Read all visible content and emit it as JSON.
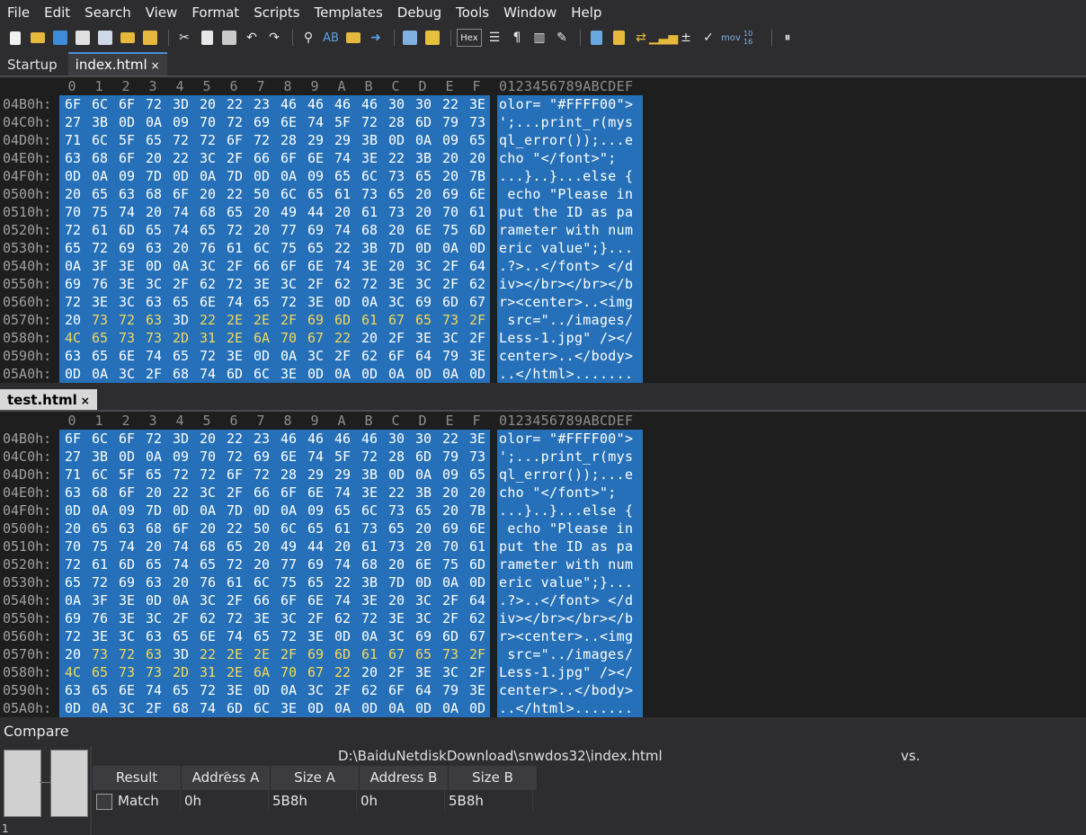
{
  "menu": [
    "File",
    "Edit",
    "Search",
    "View",
    "Format",
    "Scripts",
    "Templates",
    "Debug",
    "Tools",
    "Window",
    "Help"
  ],
  "toolbar": {
    "icons": [
      "new-file-icon",
      "open-folder-icon",
      "save-icon",
      "save-as-icon",
      "save-all-icon",
      "close-folder-icon",
      "open-project-icon",
      "cut-icon",
      "copy-icon",
      "paste-icon",
      "undo-icon",
      "redo-icon",
      "find-icon",
      "replace-icon",
      "find-in-files-icon",
      "goto-icon",
      "compare-icon",
      "bookmark-icon",
      "hex-view-icon",
      "format-icon",
      "paragraph-icon",
      "columns-icon",
      "highlight-icon",
      "calculator-icon",
      "clipboard-icon",
      "swap-icon",
      "histogram-icon",
      "plus-minus-icon",
      "checksum-icon",
      "mov-asm-icon",
      "base-convert-icon",
      "pause-icon"
    ],
    "hex_label": "Hex",
    "mov_label": "mov",
    "base_label": "10 16"
  },
  "tabs_top": [
    {
      "label": "Startup"
    },
    {
      "label": "index.html",
      "close": "×"
    }
  ],
  "tabs_bottom": [
    {
      "label": "test.html",
      "close": "×"
    }
  ],
  "hex_header": {
    "columns": [
      "0",
      "1",
      "2",
      "3",
      "4",
      "5",
      "6",
      "7",
      "8",
      "9",
      "A",
      "B",
      "C",
      "D",
      "E",
      "F"
    ],
    "ascii_header": "0123456789ABCDEF"
  },
  "hex_rows": [
    {
      "addr": "04B0h:",
      "bytes": [
        "6F",
        "6C",
        "6F",
        "72",
        "3D",
        "20",
        "22",
        "23",
        "46",
        "46",
        "46",
        "46",
        "30",
        "30",
        "22",
        "3E"
      ],
      "ascii": "olor= \"#FFFF00\">"
    },
    {
      "addr": "04C0h:",
      "bytes": [
        "27",
        "3B",
        "0D",
        "0A",
        "09",
        "70",
        "72",
        "69",
        "6E",
        "74",
        "5F",
        "72",
        "28",
        "6D",
        "79",
        "73"
      ],
      "ascii": "';...print_r(mys"
    },
    {
      "addr": "04D0h:",
      "bytes": [
        "71",
        "6C",
        "5F",
        "65",
        "72",
        "72",
        "6F",
        "72",
        "28",
        "29",
        "29",
        "3B",
        "0D",
        "0A",
        "09",
        "65"
      ],
      "ascii": "ql_error());...e"
    },
    {
      "addr": "04E0h:",
      "bytes": [
        "63",
        "68",
        "6F",
        "20",
        "22",
        "3C",
        "2F",
        "66",
        "6F",
        "6E",
        "74",
        "3E",
        "22",
        "3B",
        "20",
        "20"
      ],
      "ascii": "cho \"</font>\";  "
    },
    {
      "addr": "04F0h:",
      "bytes": [
        "0D",
        "0A",
        "09",
        "7D",
        "0D",
        "0A",
        "7D",
        "0D",
        "0A",
        "09",
        "65",
        "6C",
        "73",
        "65",
        "20",
        "7B"
      ],
      "ascii": "...}..}...else {"
    },
    {
      "addr": "0500h:",
      "bytes": [
        "20",
        "65",
        "63",
        "68",
        "6F",
        "20",
        "22",
        "50",
        "6C",
        "65",
        "61",
        "73",
        "65",
        "20",
        "69",
        "6E"
      ],
      "ascii": " echo \"Please in"
    },
    {
      "addr": "0510h:",
      "bytes": [
        "70",
        "75",
        "74",
        "20",
        "74",
        "68",
        "65",
        "20",
        "49",
        "44",
        "20",
        "61",
        "73",
        "20",
        "70",
        "61"
      ],
      "ascii": "put the ID as pa"
    },
    {
      "addr": "0520h:",
      "bytes": [
        "72",
        "61",
        "6D",
        "65",
        "74",
        "65",
        "72",
        "20",
        "77",
        "69",
        "74",
        "68",
        "20",
        "6E",
        "75",
        "6D"
      ],
      "ascii": "rameter with num"
    },
    {
      "addr": "0530h:",
      "bytes": [
        "65",
        "72",
        "69",
        "63",
        "20",
        "76",
        "61",
        "6C",
        "75",
        "65",
        "22",
        "3B",
        "7D",
        "0D",
        "0A",
        "0D"
      ],
      "ascii": "eric value\";}..."
    },
    {
      "addr": "0540h:",
      "bytes": [
        "0A",
        "3F",
        "3E",
        "0D",
        "0A",
        "3C",
        "2F",
        "66",
        "6F",
        "6E",
        "74",
        "3E",
        "20",
        "3C",
        "2F",
        "64"
      ],
      "ascii": ".?>..</font> </d"
    },
    {
      "addr": "0550h:",
      "bytes": [
        "69",
        "76",
        "3E",
        "3C",
        "2F",
        "62",
        "72",
        "3E",
        "3C",
        "2F",
        "62",
        "72",
        "3E",
        "3C",
        "2F",
        "62"
      ],
      "ascii": "iv></br></br></b"
    },
    {
      "addr": "0560h:",
      "bytes": [
        "72",
        "3E",
        "3C",
        "63",
        "65",
        "6E",
        "74",
        "65",
        "72",
        "3E",
        "0D",
        "0A",
        "3C",
        "69",
        "6D",
        "67"
      ],
      "ascii": "r><center>..<img"
    },
    {
      "addr": "0570h:",
      "bytes": [
        "20",
        "73",
        "72",
        "63",
        "3D",
        "22",
        "2E",
        "2E",
        "2F",
        "69",
        "6D",
        "61",
        "67",
        "65",
        "73",
        "2F"
      ],
      "ascii": " src=\"../images/"
    },
    {
      "addr": "0580h:",
      "bytes": [
        "4C",
        "65",
        "73",
        "73",
        "2D",
        "31",
        "2E",
        "6A",
        "70",
        "67",
        "22",
        "20",
        "2F",
        "3E",
        "3C",
        "2F"
      ],
      "ascii": "Less-1.jpg\" /></"
    },
    {
      "addr": "0590h:",
      "bytes": [
        "63",
        "65",
        "6E",
        "74",
        "65",
        "72",
        "3E",
        "0D",
        "0A",
        "3C",
        "2F",
        "62",
        "6F",
        "64",
        "79",
        "3E"
      ],
      "ascii": "center>..</body>"
    },
    {
      "addr": "05A0h:",
      "bytes": [
        "0D",
        "0A",
        "3C",
        "2F",
        "68",
        "74",
        "6D",
        "6C",
        "3E",
        "0D",
        "0A",
        "0D",
        "0A",
        "0D",
        "0A",
        "0D"
      ],
      "ascii": "..</html>......."
    }
  ],
  "compare": {
    "title": "Compare",
    "path_a": "D:\\BaiduNetdiskDownload\\snwdos32\\index.html",
    "vs": "vs.",
    "page_num": "1",
    "columns": [
      "Result",
      "Address A",
      "Size A",
      "Address B",
      "Size B"
    ],
    "rows": [
      {
        "result": "Match",
        "address_a": "0h",
        "size_a": "5B8h",
        "address_b": "0h",
        "size_b": "5B8h"
      }
    ]
  },
  "colors": {
    "selection": "#2570b8",
    "highlight_text": "#f5d85a",
    "background": "#1e1e1e"
  }
}
